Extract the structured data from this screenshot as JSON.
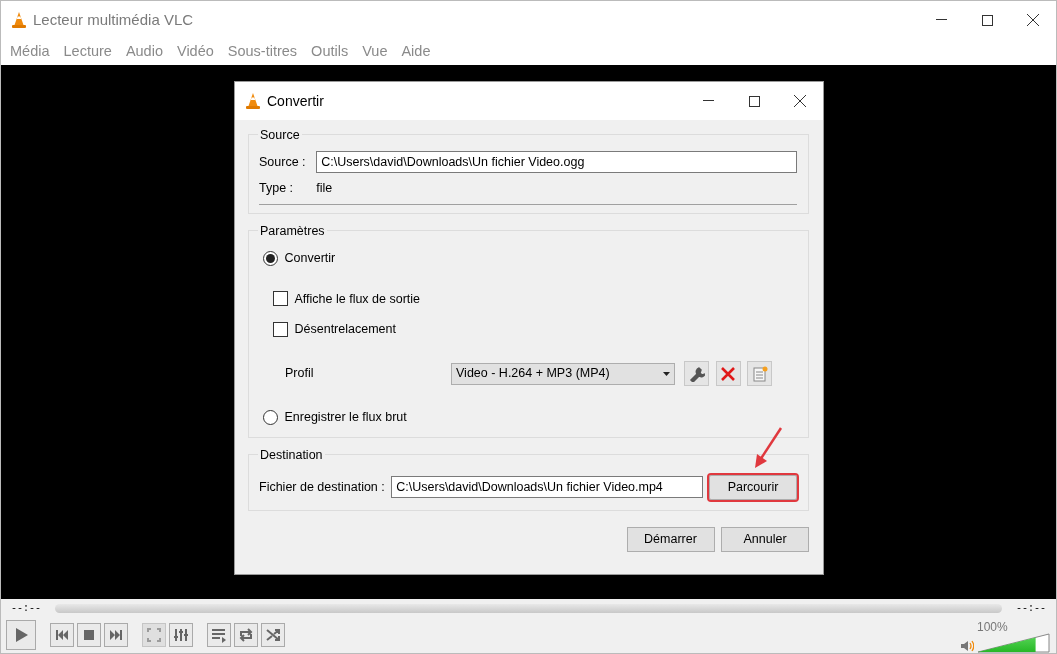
{
  "window": {
    "title": "Lecteur multimédia VLC",
    "menu": [
      "Média",
      "Lecture",
      "Audio",
      "Vidéo",
      "Sous-titres",
      "Outils",
      "Vue",
      "Aide"
    ]
  },
  "dialog": {
    "title": "Convertir",
    "source": {
      "legend": "Source",
      "source_label": "Source :",
      "source_value": "C:\\Users\\david\\Downloads\\Un fichier Video.ogg",
      "type_label": "Type :",
      "type_value": "file"
    },
    "settings": {
      "legend": "Paramètres",
      "modes": [
        {
          "label": "Convertir",
          "selected": true,
          "children": [
            {
              "label": "Affiche le flux de sortie",
              "checked": false
            },
            {
              "label": "Désentrelacement",
              "checked": false
            }
          ],
          "profile": {
            "label": "Profil",
            "value": "Video - H.264 + MP3 (MP4)"
          }
        },
        {
          "label": "Enregistrer le flux brut",
          "selected": false
        }
      ]
    },
    "destination": {
      "legend": "Destination",
      "label": "Fichier de destination :",
      "value": "C:\\Users\\david\\Downloads\\Un fichier Video.mp4",
      "button": "Parcourir",
      "highlighted": true
    },
    "buttons": [
      "Démarrer",
      "Annuler"
    ]
  },
  "player": {
    "elapsed": "--:--",
    "remaining": "--:--",
    "control_groups": [
      [
        {
          "kind": "play",
          "disabled": false
        }
      ],
      [
        {
          "kind": "previous",
          "disabled": false
        },
        {
          "kind": "stop",
          "disabled": false
        },
        {
          "kind": "next",
          "disabled": false
        }
      ],
      [
        {
          "kind": "fullscreen",
          "disabled": true
        },
        {
          "kind": "extended",
          "disabled": false
        }
      ],
      [
        {
          "kind": "playlist",
          "disabled": false
        },
        {
          "kind": "loop",
          "disabled": false
        },
        {
          "kind": "shuffle",
          "disabled": false
        }
      ]
    ],
    "volume": {
      "reading": "100%",
      "level": 0.8
    }
  }
}
